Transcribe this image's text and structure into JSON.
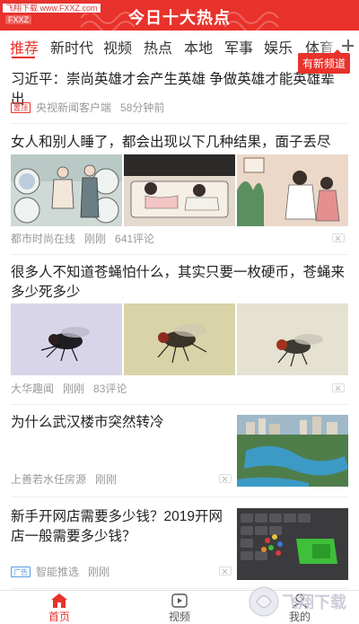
{
  "watermark": {
    "site": "飞翔下载 www.FXXZ.com",
    "short": "FXXZ"
  },
  "header": {
    "title": "今日十大热点"
  },
  "tabs": [
    "推荐",
    "新时代",
    "视频",
    "热点",
    "本地",
    "军事",
    "娱乐",
    "体育"
  ],
  "active_tab": "推荐",
  "new_channel_tip": "有新频道",
  "articles": [
    {
      "title": "习近平：崇尚英雄才会产生英雄 争做英雄才能英雄辈出",
      "tag": "置顶",
      "source": "央视新闻客户端",
      "time": "58分钟前"
    },
    {
      "title": "女人和别人睡了，都会出现以下几种结果，面子丢尽",
      "source": "都市时尚在线",
      "time": "刚刚",
      "comments": "641评论"
    },
    {
      "title": "很多人不知道苍蝇怕什么，其实只要一枚硬币，苍蝇来多少死多少",
      "source": "大华趣闻",
      "time": "刚刚",
      "comments": "83评论"
    },
    {
      "title": "为什么武汉楼市突然转冷",
      "source": "上善若水任房源",
      "time": "刚刚"
    },
    {
      "title": "新手开网店需要多少钱？2019开网店一般需要多少钱？",
      "tag": "广告",
      "source": "智能推选",
      "time": "刚刚"
    }
  ],
  "bottom_nav": [
    {
      "label": "首页",
      "icon": "home-icon",
      "active": true
    },
    {
      "label": "视频",
      "icon": "video-icon",
      "active": false
    },
    {
      "label": "我的",
      "icon": "user-icon",
      "active": false
    }
  ],
  "watermark_bottom": "飞翔下载",
  "colors": {
    "brand": "#e8322b",
    "text": "#222222",
    "meta": "#999999",
    "ad": "#5a9be0"
  }
}
